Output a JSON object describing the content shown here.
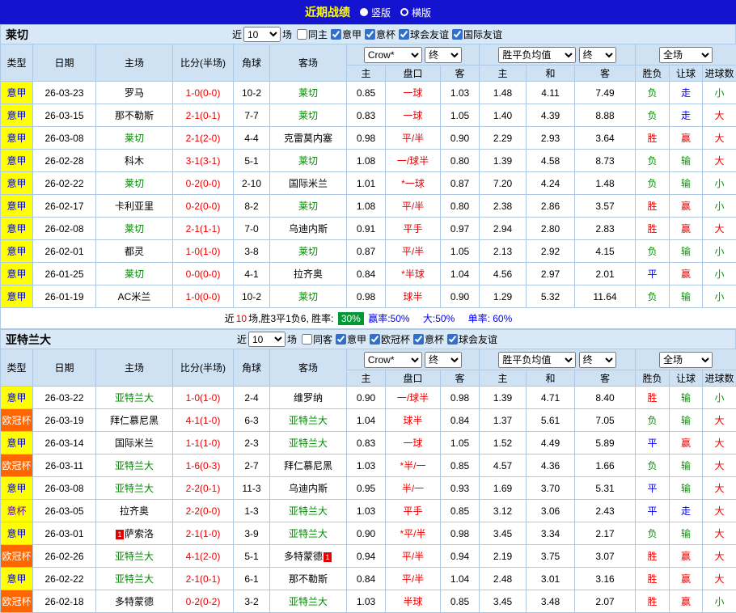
{
  "topbar": {
    "title": "近期战绩",
    "view_vertical": "竖版",
    "view_horizontal": "横版"
  },
  "colors": {
    "topbar_bg": "#1414d0",
    "title_yellow": "#ffff00",
    "accent_blue": "#0000dd",
    "league_yellow": "#ffff00",
    "league_orange": "#ff6600",
    "cup_purple": "#6600cc",
    "focus_green": "#008800",
    "score_red": "#ee0000",
    "win_red": "#ee0000",
    "draw_blue": "#0000ee",
    "lose_green": "#009900",
    "badge_green_bg": "#009933",
    "header_bg": "#cfe2f4",
    "teambar_bg": "#d8e8f7",
    "grid_line": "#aec9e3",
    "checkbox_blue": "#2f6fd0"
  },
  "sections": [
    {
      "team": "莱切",
      "filter": {
        "near_label": "近",
        "count": "10",
        "games_label": "场",
        "checkboxes": [
          {
            "label": "同主",
            "checked": false
          },
          {
            "label": "意甲",
            "checked": true
          },
          {
            "label": "意杯",
            "checked": true
          },
          {
            "label": "球会友谊",
            "checked": true
          },
          {
            "label": "国际友谊",
            "checked": true
          }
        ]
      },
      "header": {
        "cols": [
          "类型",
          "日期",
          "主场",
          "比分(半场)",
          "角球",
          "客场"
        ],
        "asia_company": "Crow*",
        "asia_time": "终",
        "europe_company": "胜平负均值",
        "europe_time": "终",
        "scope": "全场",
        "sub": [
          "主",
          "盘口",
          "客",
          "主",
          "和",
          "客",
          "胜负",
          "让球",
          "进球数"
        ]
      },
      "rows": [
        {
          "type": "意甲",
          "date": "26-03-23",
          "home": "罗马",
          "score": "1-0(0-0)",
          "corner": "10-2",
          "away": "莱切",
          "ah": "0.85",
          "hc": "一球",
          "aa": "1.03",
          "eh": "1.48",
          "ed": "4.11",
          "ea": "7.49",
          "r1": "负",
          "r2": "走",
          "r3": "小"
        },
        {
          "type": "意甲",
          "date": "26-03-15",
          "home": "那不勒斯",
          "score": "2-1(0-1)",
          "corner": "7-7",
          "away": "莱切",
          "ah": "0.83",
          "hc": "一球",
          "aa": "1.05",
          "eh": "1.40",
          "ed": "4.39",
          "ea": "8.88",
          "r1": "负",
          "r2": "走",
          "r3": "大"
        },
        {
          "type": "意甲",
          "date": "26-03-08",
          "home": "莱切",
          "score": "2-1(2-0)",
          "corner": "4-4",
          "away": "克雷莫内塞",
          "ah": "0.98",
          "hc": "平/半",
          "aa": "0.90",
          "eh": "2.29",
          "ed": "2.93",
          "ea": "3.64",
          "r1": "胜",
          "r2": "赢",
          "r3": "大"
        },
        {
          "type": "意甲",
          "date": "26-02-28",
          "home": "科木",
          "score": "3-1(3-1)",
          "corner": "5-1",
          "away": "莱切",
          "ah": "1.08",
          "hc": "一/球半",
          "aa": "0.80",
          "eh": "1.39",
          "ed": "4.58",
          "ea": "8.73",
          "r1": "负",
          "r2": "输",
          "r3": "大"
        },
        {
          "type": "意甲",
          "date": "26-02-22",
          "home": "莱切",
          "score": "0-2(0-0)",
          "corner": "2-10",
          "away": "国际米兰",
          "ah": "1.01",
          "hc": "*一球",
          "aa": "0.87",
          "eh": "7.20",
          "ed": "4.24",
          "ea": "1.48",
          "r1": "负",
          "r2": "输",
          "r3": "小"
        },
        {
          "type": "意甲",
          "date": "26-02-17",
          "home": "卡利亚里",
          "score": "0-2(0-0)",
          "corner": "8-2",
          "away": "莱切",
          "ah": "1.08",
          "hc": "平/半",
          "aa": "0.80",
          "eh": "2.38",
          "ed": "2.86",
          "ea": "3.57",
          "r1": "胜",
          "r2": "赢",
          "r3": "小"
        },
        {
          "type": "意甲",
          "date": "26-02-08",
          "home": "莱切",
          "score": "2-1(1-1)",
          "corner": "7-0",
          "away": "乌迪内斯",
          "ah": "0.91",
          "hc": "平手",
          "aa": "0.97",
          "eh": "2.94",
          "ed": "2.80",
          "ea": "2.83",
          "r1": "胜",
          "r2": "赢",
          "r3": "大"
        },
        {
          "type": "意甲",
          "date": "26-02-01",
          "home": "都灵",
          "score": "1-0(1-0)",
          "corner": "3-8",
          "away": "莱切",
          "ah": "0.87",
          "hc": "平/半",
          "aa": "1.05",
          "eh": "2.13",
          "ed": "2.92",
          "ea": "4.15",
          "r1": "负",
          "r2": "输",
          "r3": "小"
        },
        {
          "type": "意甲",
          "date": "26-01-25",
          "home": "莱切",
          "score": "0-0(0-0)",
          "corner": "4-1",
          "away": "拉齐奥",
          "ah": "0.84",
          "hc": "*半球",
          "aa": "1.04",
          "eh": "4.56",
          "ed": "2.97",
          "ea": "2.01",
          "r1": "平",
          "r2": "赢",
          "r3": "小"
        },
        {
          "type": "意甲",
          "date": "26-01-19",
          "home": "AC米兰",
          "score": "1-0(0-0)",
          "corner": "10-2",
          "away": "莱切",
          "ah": "0.98",
          "hc": "球半",
          "aa": "0.90",
          "eh": "1.29",
          "ed": "5.32",
          "ea": "11.64",
          "r1": "负",
          "r2": "输",
          "r3": "小"
        }
      ],
      "summary": {
        "p1": "近",
        "count": "10",
        "p2": "场,胜3平1负6, 胜率:",
        "win_rate": "30%",
        "s1": "赢率:50%",
        "s2": "大:50%",
        "s3": "单率: 60%"
      }
    },
    {
      "team": "亚特兰大",
      "filter": {
        "near_label": "近",
        "count": "10",
        "games_label": "场",
        "checkboxes": [
          {
            "label": "同客",
            "checked": false
          },
          {
            "label": "意甲",
            "checked": true
          },
          {
            "label": "欧冠杯",
            "checked": true
          },
          {
            "label": "意杯",
            "checked": true
          },
          {
            "label": "球会友谊",
            "checked": true
          }
        ]
      },
      "header": {
        "cols": [
          "类型",
          "日期",
          "主场",
          "比分(半场)",
          "角球",
          "客场"
        ],
        "asia_company": "Crow*",
        "asia_time": "终",
        "europe_company": "胜平负均值",
        "europe_time": "终",
        "scope": "全场",
        "sub": [
          "主",
          "盘口",
          "客",
          "主",
          "和",
          "客",
          "胜负",
          "让球",
          "进球数"
        ]
      },
      "rows": [
        {
          "type": "意甲",
          "date": "26-03-22",
          "home": "亚特兰大",
          "score": "1-0(1-0)",
          "corner": "2-4",
          "away": "维罗纳",
          "ah": "0.90",
          "hc": "一/球半",
          "aa": "0.98",
          "eh": "1.39",
          "ed": "4.71",
          "ea": "8.40",
          "r1": "胜",
          "r2": "输",
          "r3": "小"
        },
        {
          "type": "欧冠杯",
          "date": "26-03-19",
          "home": "拜仁慕尼黑",
          "score": "4-1(1-0)",
          "corner": "6-3",
          "away": "亚特兰大",
          "ah": "1.04",
          "hc": "球半",
          "aa": "0.84",
          "eh": "1.37",
          "ed": "5.61",
          "ea": "7.05",
          "r1": "负",
          "r2": "输",
          "r3": "大"
        },
        {
          "type": "意甲",
          "date": "26-03-14",
          "home": "国际米兰",
          "score": "1-1(1-0)",
          "corner": "2-3",
          "away": "亚特兰大",
          "ah": "0.83",
          "hc": "一球",
          "aa": "1.05",
          "eh": "1.52",
          "ed": "4.49",
          "ea": "5.89",
          "r1": "平",
          "r2": "赢",
          "r3": "大"
        },
        {
          "type": "欧冠杯",
          "date": "26-03-11",
          "home": "亚特兰大",
          "score": "1-6(0-3)",
          "corner": "2-7",
          "away": "拜仁慕尼黑",
          "ah": "1.03",
          "hc": "*半/一",
          "aa": "0.85",
          "eh": "4.57",
          "ed": "4.36",
          "ea": "1.66",
          "r1": "负",
          "r2": "输",
          "r3": "大"
        },
        {
          "type": "意甲",
          "date": "26-03-08",
          "home": "亚特兰大",
          "score": "2-2(0-1)",
          "corner": "11-3",
          "away": "乌迪内斯",
          "ah": "0.95",
          "hc": "半/一",
          "aa": "0.93",
          "eh": "1.69",
          "ed": "3.70",
          "ea": "5.31",
          "r1": "平",
          "r2": "输",
          "r3": "大"
        },
        {
          "type": "意杯",
          "date": "26-03-05",
          "home": "拉齐奥",
          "score": "2-2(0-0)",
          "corner": "1-3",
          "away": "亚特兰大",
          "ah": "1.03",
          "hc": "平手",
          "aa": "0.85",
          "eh": "3.12",
          "ed": "3.06",
          "ea": "2.43",
          "r1": "平",
          "r2": "走",
          "r3": "大"
        },
        {
          "type": "意甲",
          "date": "26-03-01",
          "home": "萨索洛",
          "homeBadge": "1",
          "score": "2-1(1-0)",
          "corner": "3-9",
          "away": "亚特兰大",
          "ah": "0.90",
          "hc": "*平/半",
          "aa": "0.98",
          "eh": "3.45",
          "ed": "3.34",
          "ea": "2.17",
          "r1": "负",
          "r2": "输",
          "r3": "大"
        },
        {
          "type": "欧冠杯",
          "date": "26-02-26",
          "home": "亚特兰大",
          "score": "4-1(2-0)",
          "corner": "5-1",
          "away": "多特蒙德",
          "awayBadge": "1",
          "ah": "0.94",
          "hc": "平/半",
          "aa": "0.94",
          "eh": "2.19",
          "ed": "3.75",
          "ea": "3.07",
          "r1": "胜",
          "r2": "赢",
          "r3": "大"
        },
        {
          "type": "意甲",
          "date": "26-02-22",
          "home": "亚特兰大",
          "score": "2-1(0-1)",
          "corner": "6-1",
          "away": "那不勒斯",
          "ah": "0.84",
          "hc": "平/半",
          "aa": "1.04",
          "eh": "2.48",
          "ed": "3.01",
          "ea": "3.16",
          "r1": "胜",
          "r2": "赢",
          "r3": "大"
        },
        {
          "type": "欧冠杯",
          "date": "26-02-18",
          "home": "多特蒙德",
          "score": "0-2(0-2)",
          "corner": "3-2",
          "away": "亚特兰大",
          "ah": "1.03",
          "hc": "半球",
          "aa": "0.85",
          "eh": "3.45",
          "ed": "3.48",
          "ea": "2.07",
          "r1": "胜",
          "r2": "赢",
          "r3": "小"
        }
      ]
    }
  ]
}
